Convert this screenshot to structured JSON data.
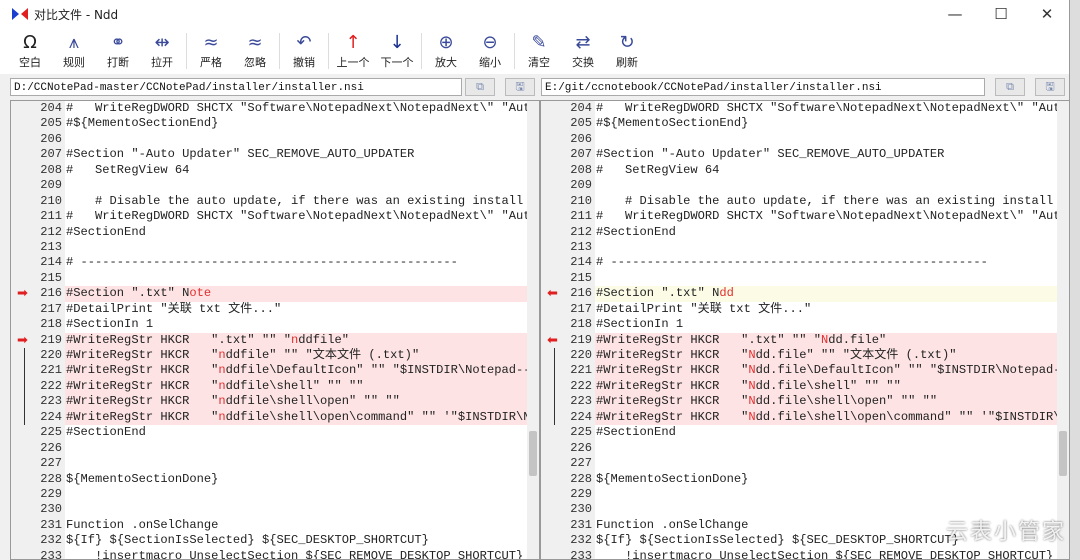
{
  "window": {
    "title": "对比文件 - Ndd",
    "minimize": "—",
    "maximize": "☐",
    "close": "✕"
  },
  "toolbar": [
    {
      "icon": "Ω",
      "label": "空白",
      "name": "whitespace"
    },
    {
      "icon": "⩚",
      "label": "规则",
      "name": "rules"
    },
    {
      "icon": "⚭",
      "label": "打断",
      "name": "break"
    },
    {
      "icon": "⇹",
      "label": "拉开",
      "name": "pull-apart"
    },
    {
      "icon": "≈",
      "label": "严格",
      "name": "strict"
    },
    {
      "icon": "≈",
      "label": "忽略",
      "name": "ignore"
    },
    {
      "icon": "↶",
      "label": "撤销",
      "name": "undo"
    },
    {
      "icon": "↑",
      "label": "上一个",
      "name": "previous"
    },
    {
      "icon": "↓",
      "label": "下一个",
      "name": "next"
    },
    {
      "icon": "⊕",
      "label": "放大",
      "name": "zoom-in"
    },
    {
      "icon": "⊖",
      "label": "缩小",
      "name": "zoom-out"
    },
    {
      "icon": "✎",
      "label": "清空",
      "name": "clear"
    },
    {
      "icon": "⇄",
      "label": "交换",
      "name": "swap"
    },
    {
      "icon": "↻",
      "label": "刷新",
      "name": "refresh"
    }
  ],
  "left": {
    "path": "D:/CCNotePad-master/CCNotePad/installer/installer.nsi",
    "lines": [
      {
        "n": "204",
        "p": [
          [
            "#   WriteRegDWORD SHCTX \"Software\\NotepadNext\\NotepadNext\\\" \"Auto",
            0
          ]
        ]
      },
      {
        "n": "205",
        "p": [
          [
            "#${MementoSectionEnd}",
            0
          ]
        ]
      },
      {
        "n": "206",
        "p": []
      },
      {
        "n": "207",
        "p": [
          [
            "#Section \"-Auto Updater\" SEC_REMOVE_AUTO_UPDATER",
            0
          ]
        ]
      },
      {
        "n": "208",
        "p": [
          [
            "#   SetRegView 64",
            0
          ]
        ]
      },
      {
        "n": "209",
        "p": []
      },
      {
        "n": "210",
        "p": [
          [
            "    # Disable the auto update, if there was an existing install",
            0
          ]
        ]
      },
      {
        "n": "211",
        "p": [
          [
            "#   WriteRegDWORD SHCTX \"Software\\NotepadNext\\NotepadNext\\\" \"Auto",
            0
          ]
        ]
      },
      {
        "n": "212",
        "p": [
          [
            "#SectionEnd",
            0
          ]
        ]
      },
      {
        "n": "213",
        "p": []
      },
      {
        "n": "214",
        "p": [
          [
            "# ----------------------------------------------------",
            0
          ]
        ]
      },
      {
        "n": "215",
        "p": []
      },
      {
        "n": "216",
        "hl": "diff",
        "mark": "arrow",
        "p": [
          [
            "#Section \".txt\" N",
            0
          ],
          [
            "ote",
            1
          ]
        ]
      },
      {
        "n": "217",
        "p": [
          [
            "#DetailPrint \"关联 txt 文件...\"",
            0
          ]
        ]
      },
      {
        "n": "218",
        "p": [
          [
            "#SectionIn 1",
            0
          ]
        ]
      },
      {
        "n": "219",
        "hl": "diff",
        "mark": "arrow",
        "p": [
          [
            "#WriteRegStr HKCR   \".txt\" \"\" \"",
            0
          ],
          [
            "n",
            1
          ],
          [
            "ddfile\"",
            0
          ]
        ]
      },
      {
        "n": "220",
        "hl": "diff",
        "mark": "bar",
        "p": [
          [
            "#WriteRegStr HKCR   \"",
            0
          ],
          [
            "n",
            1
          ],
          [
            "ddfile\" \"\" \"文本文件 (.txt)\"",
            0
          ]
        ]
      },
      {
        "n": "221",
        "hl": "diff",
        "mark": "bar",
        "p": [
          [
            "#WriteRegStr HKCR   \"",
            0
          ],
          [
            "n",
            1
          ],
          [
            "ddfile\\DefaultIcon\" \"\" \"$INSTDIR\\Notepad--.exe",
            0
          ]
        ]
      },
      {
        "n": "222",
        "hl": "diff",
        "mark": "bar",
        "p": [
          [
            "#WriteRegStr HKCR   \"",
            0
          ],
          [
            "n",
            1
          ],
          [
            "ddfile\\shell\" \"\" \"\"",
            0
          ]
        ]
      },
      {
        "n": "223",
        "hl": "diff",
        "mark": "bar",
        "p": [
          [
            "#WriteRegStr HKCR   \"",
            0
          ],
          [
            "n",
            1
          ],
          [
            "ddfile\\shell\\open\" \"\" \"\"",
            0
          ]
        ]
      },
      {
        "n": "224",
        "hl": "diff",
        "mark": "bar",
        "p": [
          [
            "#WriteRegStr HKCR   \"",
            0
          ],
          [
            "n",
            1
          ],
          [
            "ddfile\\shell\\open\\command\" \"\" '\"$INSTDIR\\Notepad",
            0
          ]
        ]
      },
      {
        "n": "225",
        "p": [
          [
            "#SectionEnd",
            0
          ]
        ]
      },
      {
        "n": "226",
        "p": []
      },
      {
        "n": "227",
        "p": []
      },
      {
        "n": "228",
        "p": [
          [
            "${MementoSectionDone}",
            0
          ]
        ]
      },
      {
        "n": "229",
        "p": []
      },
      {
        "n": "230",
        "p": []
      },
      {
        "n": "231",
        "p": [
          [
            "Function .onSelChange",
            0
          ]
        ]
      },
      {
        "n": "232",
        "p": [
          [
            "${If} ${SectionIsSelected} ${SEC_DESKTOP_SHORTCUT}",
            0
          ]
        ]
      },
      {
        "n": "233",
        "p": [
          [
            "    !insertmacro UnselectSection ${SEC_REMOVE_DESKTOP_SHORTCUT}",
            0
          ]
        ]
      }
    ]
  },
  "right": {
    "path": "E:/git/ccnotebook/CCNotePad/installer/installer.nsi",
    "lines": [
      {
        "n": "204",
        "p": [
          [
            "#   WriteRegDWORD SHCTX \"Software\\NotepadNext\\NotepadNext\\\" \"Auto",
            0
          ]
        ]
      },
      {
        "n": "205",
        "p": [
          [
            "#${MementoSectionEnd}",
            0
          ]
        ]
      },
      {
        "n": "206",
        "p": []
      },
      {
        "n": "207",
        "p": [
          [
            "#Section \"-Auto Updater\" SEC_REMOVE_AUTO_UPDATER",
            0
          ]
        ]
      },
      {
        "n": "208",
        "p": [
          [
            "#   SetRegView 64",
            0
          ]
        ]
      },
      {
        "n": "209",
        "p": []
      },
      {
        "n": "210",
        "p": [
          [
            "    # Disable the auto update, if there was an existing install",
            0
          ]
        ]
      },
      {
        "n": "211",
        "p": [
          [
            "#   WriteRegDWORD SHCTX \"Software\\NotepadNext\\NotepadNext\\\" \"Auto",
            0
          ]
        ]
      },
      {
        "n": "212",
        "p": [
          [
            "#SectionEnd",
            0
          ]
        ]
      },
      {
        "n": "213",
        "p": []
      },
      {
        "n": "214",
        "p": [
          [
            "# ----------------------------------------------------",
            0
          ]
        ]
      },
      {
        "n": "215",
        "p": []
      },
      {
        "n": "216",
        "hl": "cur",
        "mark": "arrow",
        "p": [
          [
            "#Section \".txt\" N",
            0
          ],
          [
            "dd",
            1
          ]
        ]
      },
      {
        "n": "217",
        "p": [
          [
            "#DetailPrint \"关联 txt 文件...\"",
            0
          ]
        ]
      },
      {
        "n": "218",
        "p": [
          [
            "#SectionIn 1",
            0
          ]
        ]
      },
      {
        "n": "219",
        "hl": "diff",
        "mark": "arrow",
        "p": [
          [
            "#WriteRegStr HKCR   \".txt\" \"\" \"",
            0
          ],
          [
            "N",
            1
          ],
          [
            "dd.file\"",
            0
          ]
        ]
      },
      {
        "n": "220",
        "hl": "diff",
        "mark": "bar",
        "p": [
          [
            "#WriteRegStr HKCR   \"",
            0
          ],
          [
            "N",
            1
          ],
          [
            "dd.file\" \"\" \"文本文件 (.txt)\"",
            0
          ]
        ]
      },
      {
        "n": "221",
        "hl": "diff",
        "mark": "bar",
        "p": [
          [
            "#WriteRegStr HKCR   \"",
            0
          ],
          [
            "N",
            1
          ],
          [
            "dd.file\\DefaultIcon\" \"\" \"$INSTDIR\\Notepad--.exe",
            0
          ]
        ]
      },
      {
        "n": "222",
        "hl": "diff",
        "mark": "bar",
        "p": [
          [
            "#WriteRegStr HKCR   \"",
            0
          ],
          [
            "N",
            1
          ],
          [
            "dd.file\\shell\" \"\" \"\"",
            0
          ]
        ]
      },
      {
        "n": "223",
        "hl": "diff",
        "mark": "bar",
        "p": [
          [
            "#WriteRegStr HKCR   \"",
            0
          ],
          [
            "N",
            1
          ],
          [
            "dd.file\\shell\\open\" \"\" \"\"",
            0
          ]
        ]
      },
      {
        "n": "224",
        "hl": "diff",
        "mark": "bar",
        "p": [
          [
            "#WriteRegStr HKCR   \"",
            0
          ],
          [
            "N",
            1
          ],
          [
            "dd.file\\shell\\open\\command\" \"\" '\"$INSTDIR\\Notepad",
            0
          ]
        ]
      },
      {
        "n": "225",
        "p": [
          [
            "#SectionEnd",
            0
          ]
        ]
      },
      {
        "n": "226",
        "p": []
      },
      {
        "n": "227",
        "p": []
      },
      {
        "n": "228",
        "p": [
          [
            "${MementoSectionDone}",
            0
          ]
        ]
      },
      {
        "n": "229",
        "p": []
      },
      {
        "n": "230",
        "p": []
      },
      {
        "n": "231",
        "p": [
          [
            "Function .onSelChange",
            0
          ]
        ]
      },
      {
        "n": "232",
        "p": [
          [
            "${If} ${SectionIsSelected} ${SEC_DESKTOP_SHORTCUT}",
            0
          ]
        ]
      },
      {
        "n": "233",
        "p": [
          [
            "    !insertmacro UnselectSection ${SEC_REMOVE_DESKTOP_SHORTCUT}",
            0
          ]
        ]
      }
    ]
  },
  "path_buttons": {
    "open": "⧉",
    "save": "🖫"
  },
  "watermark": "云表小管家"
}
